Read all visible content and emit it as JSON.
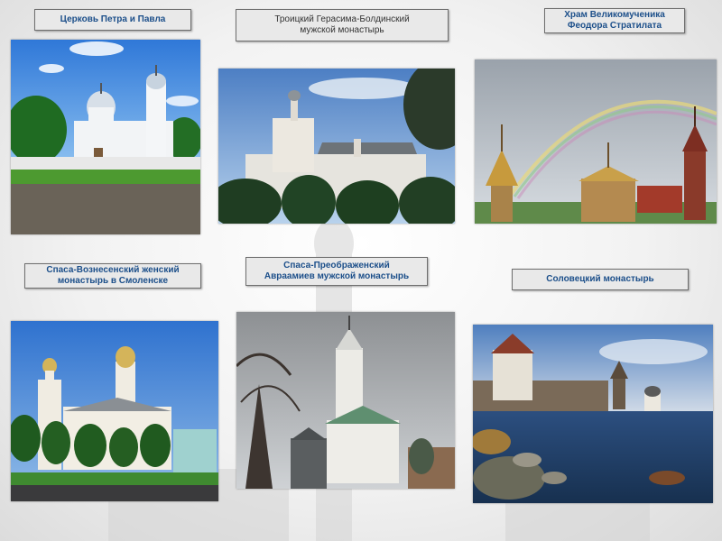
{
  "slide": {
    "items": [
      {
        "title": "Церковь Петра и Павла",
        "photo": "church-peter-paul-photo"
      },
      {
        "title_line1": "Троицкий Герасима-Болдинский",
        "title_line2": "мужской монастырь",
        "photo": "troitsky-monastery-photo"
      },
      {
        "title_line1": "Храм Великомученика",
        "title_line2": "Феодора Стратилата",
        "photo": "fyodor-stratilat-temple-photo"
      },
      {
        "title_line1": "Спаса-Вознесенский женский",
        "title_line2": "монастырь в Смоленске",
        "photo": "spaso-voznesensky-convent-photo"
      },
      {
        "title_line1": "Спаса-Преображенский",
        "title_line2": "Авраамиев мужской монастырь",
        "photo": "avraamiev-monastery-photo"
      },
      {
        "title": "Соловецкий монастырь",
        "photo": "solovetsky-monastery-photo"
      }
    ]
  },
  "colors": {
    "label_text": "#1c4f8a",
    "label_bg": "#e9e9e9",
    "sky": "#3b7fd6",
    "grass": "#3d8f2c"
  }
}
